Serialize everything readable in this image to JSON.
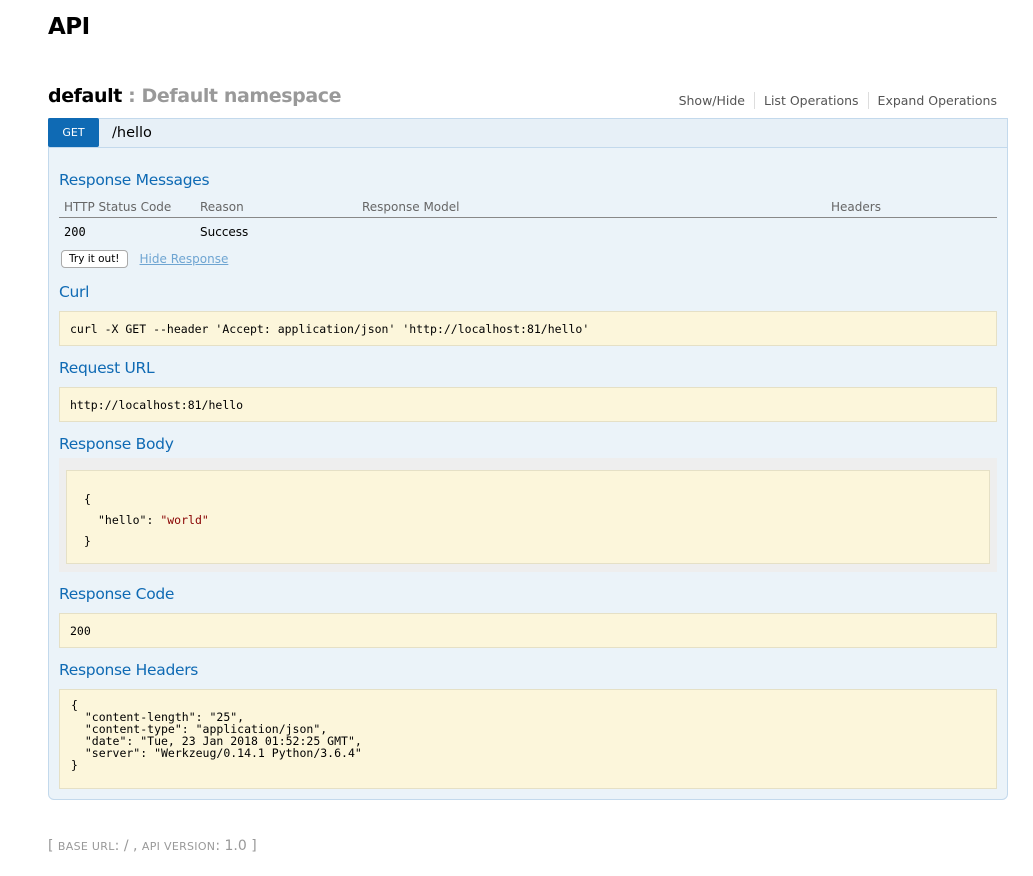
{
  "page": {
    "title": "API"
  },
  "namespace": {
    "name": "default",
    "separator": " : ",
    "description": "Default namespace",
    "actions": [
      "Show/Hide",
      "List Operations",
      "Expand Operations"
    ]
  },
  "operation": {
    "method": "GET",
    "path": "/hello",
    "method_color": "#0f6ab4",
    "response_messages": {
      "title": "Response Messages",
      "columns": [
        "HTTP Status Code",
        "Reason",
        "Response Model",
        "Headers"
      ],
      "rows": [
        {
          "code": "200",
          "reason": "Success",
          "model": "",
          "headers": ""
        }
      ]
    },
    "try_button": "Try it out!",
    "hide_response_link": "Hide Response",
    "curl": {
      "title": "Curl",
      "value": "curl -X GET --header 'Accept: application/json' 'http://localhost:81/hello'"
    },
    "request_url": {
      "title": "Request URL",
      "value": "http://localhost:81/hello"
    },
    "response_body": {
      "title": "Response Body",
      "open": "{",
      "key": "\"hello\"",
      "colon": ": ",
      "value": "\"world\"",
      "close": "}"
    },
    "response_code": {
      "title": "Response Code",
      "value": "200"
    },
    "response_headers": {
      "title": "Response Headers",
      "value": "{\n  \"content-length\": \"25\",\n  \"content-type\": \"application/json\",\n  \"date\": \"Tue, 23 Jan 2018 01:52:25 GMT\",\n  \"server\": \"Werkzeug/0.14.1 Python/3.6.4\"\n}"
    }
  },
  "footer": {
    "open": "[ ",
    "base_url_label": "Base url",
    "base_url_value": ": / , ",
    "api_version_label": "api version",
    "api_version_value": ": 1.0",
    "close": " ]"
  }
}
